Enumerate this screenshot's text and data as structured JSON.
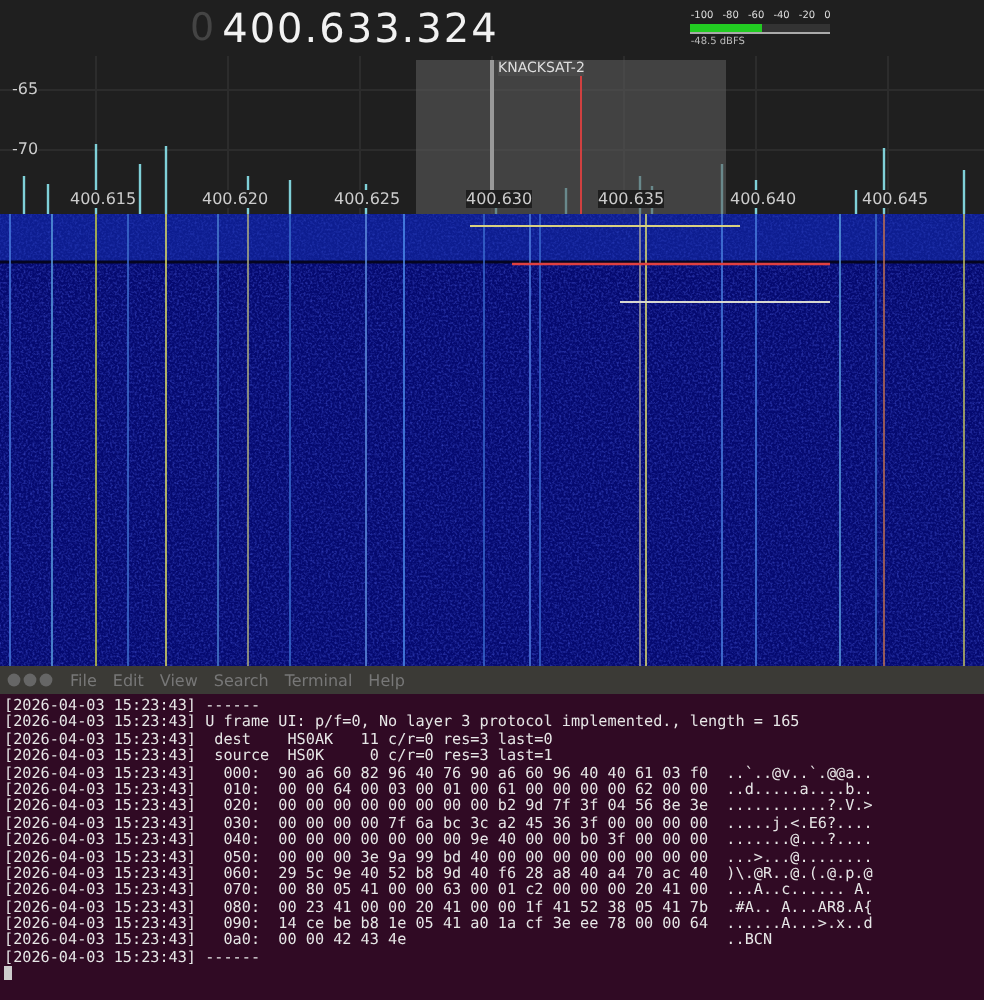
{
  "receiver": {
    "frequency_prefix": "0",
    "frequency": "400.633.324",
    "meter": {
      "scale": [
        "-100",
        "-80",
        "-60",
        "-40",
        "-20",
        "0"
      ],
      "level": 0.515,
      "reading": "-48.5 dBFS"
    }
  },
  "spectrum": {
    "y_labels": [
      "-65",
      "-70"
    ],
    "x_labels": [
      "400.615",
      "400.620",
      "400.625",
      "400.630",
      "400.635",
      "400.640",
      "400.645"
    ],
    "passband": {
      "label": "KNACKSAT-2"
    }
  },
  "terminal": {
    "menu": [
      "File",
      "Edit",
      "View",
      "Search",
      "Terminal",
      "Help"
    ],
    "lines": [
      {
        "timestamp": "[2026-04-03 15:23:43]",
        "message": " ------"
      },
      {
        "timestamp": "[2026-04-03 15:23:43]",
        "message": " U frame UI: p/f=0, No layer 3 protocol implemented., length = 165"
      },
      {
        "timestamp": "[2026-04-03 15:23:43]",
        "message": "  dest    HS0AK   11 c/r=0 res=3 last=0"
      },
      {
        "timestamp": "[2026-04-03 15:23:43]",
        "message": "  source  HS0K     0 c/r=0 res=3 last=1"
      },
      {
        "timestamp": "[2026-04-03 15:23:43]",
        "message": "   000:  90 a6 60 82 96 40 76 90 a6 60 96 40 40 61 03 f0  ..`..@v..`.@@a.."
      },
      {
        "timestamp": "[2026-04-03 15:23:43]",
        "message": "   010:  00 00 64 00 03 00 01 00 61 00 00 00 00 62 00 00  ..d.....a....b.."
      },
      {
        "timestamp": "[2026-04-03 15:23:43]",
        "message": "   020:  00 00 00 00 00 00 00 00 b2 9d 7f 3f 04 56 8e 3e  ...........?.V.>"
      },
      {
        "timestamp": "[2026-04-03 15:23:43]",
        "message": "   030:  00 00 00 00 7f 6a bc 3c a2 45 36 3f 00 00 00 00  .....j.<.E6?...."
      },
      {
        "timestamp": "[2026-04-03 15:23:43]",
        "message": "   040:  00 00 00 00 00 00 00 9e 40 00 00 b0 3f 00 00 00  .......@...?...."
      },
      {
        "timestamp": "[2026-04-03 15:23:43]",
        "message": "   050:  00 00 00 3e 9a 99 bd 40 00 00 00 00 00 00 00 00  ...>...@........"
      },
      {
        "timestamp": "[2026-04-03 15:23:43]",
        "message": "   060:  29 5c 9e 40 52 b8 9d 40 f6 28 a8 40 a4 70 ac 40  )\\.@R..@.(.@.p.@"
      },
      {
        "timestamp": "[2026-04-03 15:23:43]",
        "message": "   070:  00 80 05 41 00 00 63 00 01 c2 00 00 00 20 41 00  ...A..c...... A."
      },
      {
        "timestamp": "[2026-04-03 15:23:43]",
        "message": "   080:  00 23 41 00 00 20 41 00 00 1f 41 52 38 05 41 7b  .#A.. A...AR8.A{"
      },
      {
        "timestamp": "[2026-04-03 15:23:43]",
        "message": "   090:  14 ce be b8 1e 05 41 a0 1a cf 3e ee 78 00 00 64  ......A...>.x..d"
      },
      {
        "timestamp": "[2026-04-03 15:23:43]",
        "message": "   0a0:  00 00 42 43 4e                                   ..BCN"
      },
      {
        "timestamp": "[2026-04-03 15:23:43]",
        "message": " ------"
      }
    ]
  }
}
